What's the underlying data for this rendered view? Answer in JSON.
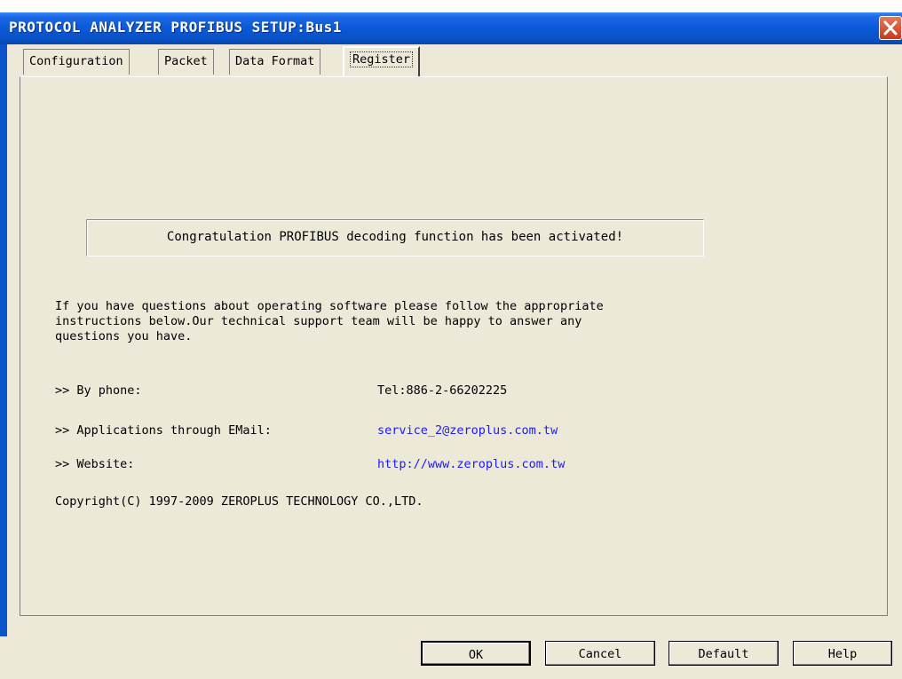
{
  "window": {
    "title": "PROTOCOL ANALYZER PROFIBUS SETUP:Bus1"
  },
  "tabs": [
    {
      "label": "Configuration",
      "active": false
    },
    {
      "label": "Packet",
      "active": false
    },
    {
      "label": "Data Format",
      "active": false
    },
    {
      "label": "Register",
      "active": true
    }
  ],
  "notice": "Congratulation PROFIBUS decoding function has been activated!",
  "intro_lines": [
    "If you have questions about operating software please follow the appropriate",
    "instructions below.Our technical support team will be happy to answer any",
    "questions you have."
  ],
  "contacts": [
    {
      "label": ">> By phone:",
      "value": "Tel:886-2-66202225",
      "link": false
    },
    {
      "label": ">> Applications through EMail:",
      "value": "service_2@zeroplus.com.tw",
      "link": true
    },
    {
      "label": ">> Website:",
      "value": "http://www.zeroplus.com.tw",
      "link": true
    }
  ],
  "copyright": "Copyright(C) 1997-2009 ZEROPLUS TECHNOLOGY CO.,LTD.",
  "buttons": {
    "ok": "OK",
    "cancel": "Cancel",
    "default": "Default",
    "help": "Help"
  },
  "colors": {
    "title_bar": "#0a53c9",
    "dialog_bg": "#ece9d8",
    "link": "#1a1aff",
    "close_button": "#d4502f"
  },
  "icons": {
    "close": "close-icon"
  }
}
